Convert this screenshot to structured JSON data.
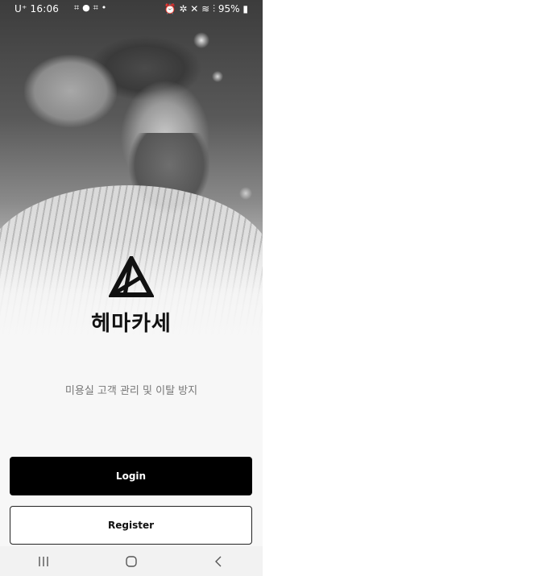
{
  "status_bar": {
    "carrier_time": "U⁺ 16:06",
    "notification_icons": [
      "screenshot-icon",
      "chat-icon",
      "screenshot-icon",
      "dot-icon"
    ],
    "system_icons": [
      "alarm-icon",
      "bluetooth-icon",
      "mute-icon",
      "wifi-icon",
      "signal-icon"
    ],
    "battery": "95%"
  },
  "hero": {
    "image": "barber-cutting-bearded-man-photo"
  },
  "brand": {
    "logo_icon": "triangle-logo-icon",
    "name": "헤마카세",
    "tagline": "미용실 고객 관리 및 이탈 방지"
  },
  "actions": {
    "login_label": "Login",
    "register_label": "Register"
  },
  "nav_bar": {
    "buttons": [
      "recent-apps-icon",
      "home-icon",
      "back-icon"
    ]
  },
  "colors": {
    "primary_button": "#000000",
    "secondary_button_bg": "#ffffff",
    "background": "#f7f7f7",
    "tagline_text": "#777777"
  }
}
